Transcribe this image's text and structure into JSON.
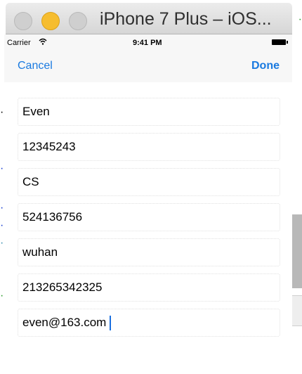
{
  "window": {
    "title": "iPhone 7 Plus – iOS..."
  },
  "status_bar": {
    "carrier": "Carrier",
    "time": "9:41 PM"
  },
  "nav": {
    "cancel": "Cancel",
    "done": "Done"
  },
  "fields": [
    {
      "value": "Even"
    },
    {
      "value": "12345243"
    },
    {
      "value": "CS"
    },
    {
      "value": "524136756"
    },
    {
      "value": "wuhan"
    },
    {
      "value": "213265342325"
    },
    {
      "value": "even@163.com"
    }
  ],
  "colors": {
    "accent": "#1a7ae0",
    "traffic_yellow": "#f6bd2f"
  }
}
